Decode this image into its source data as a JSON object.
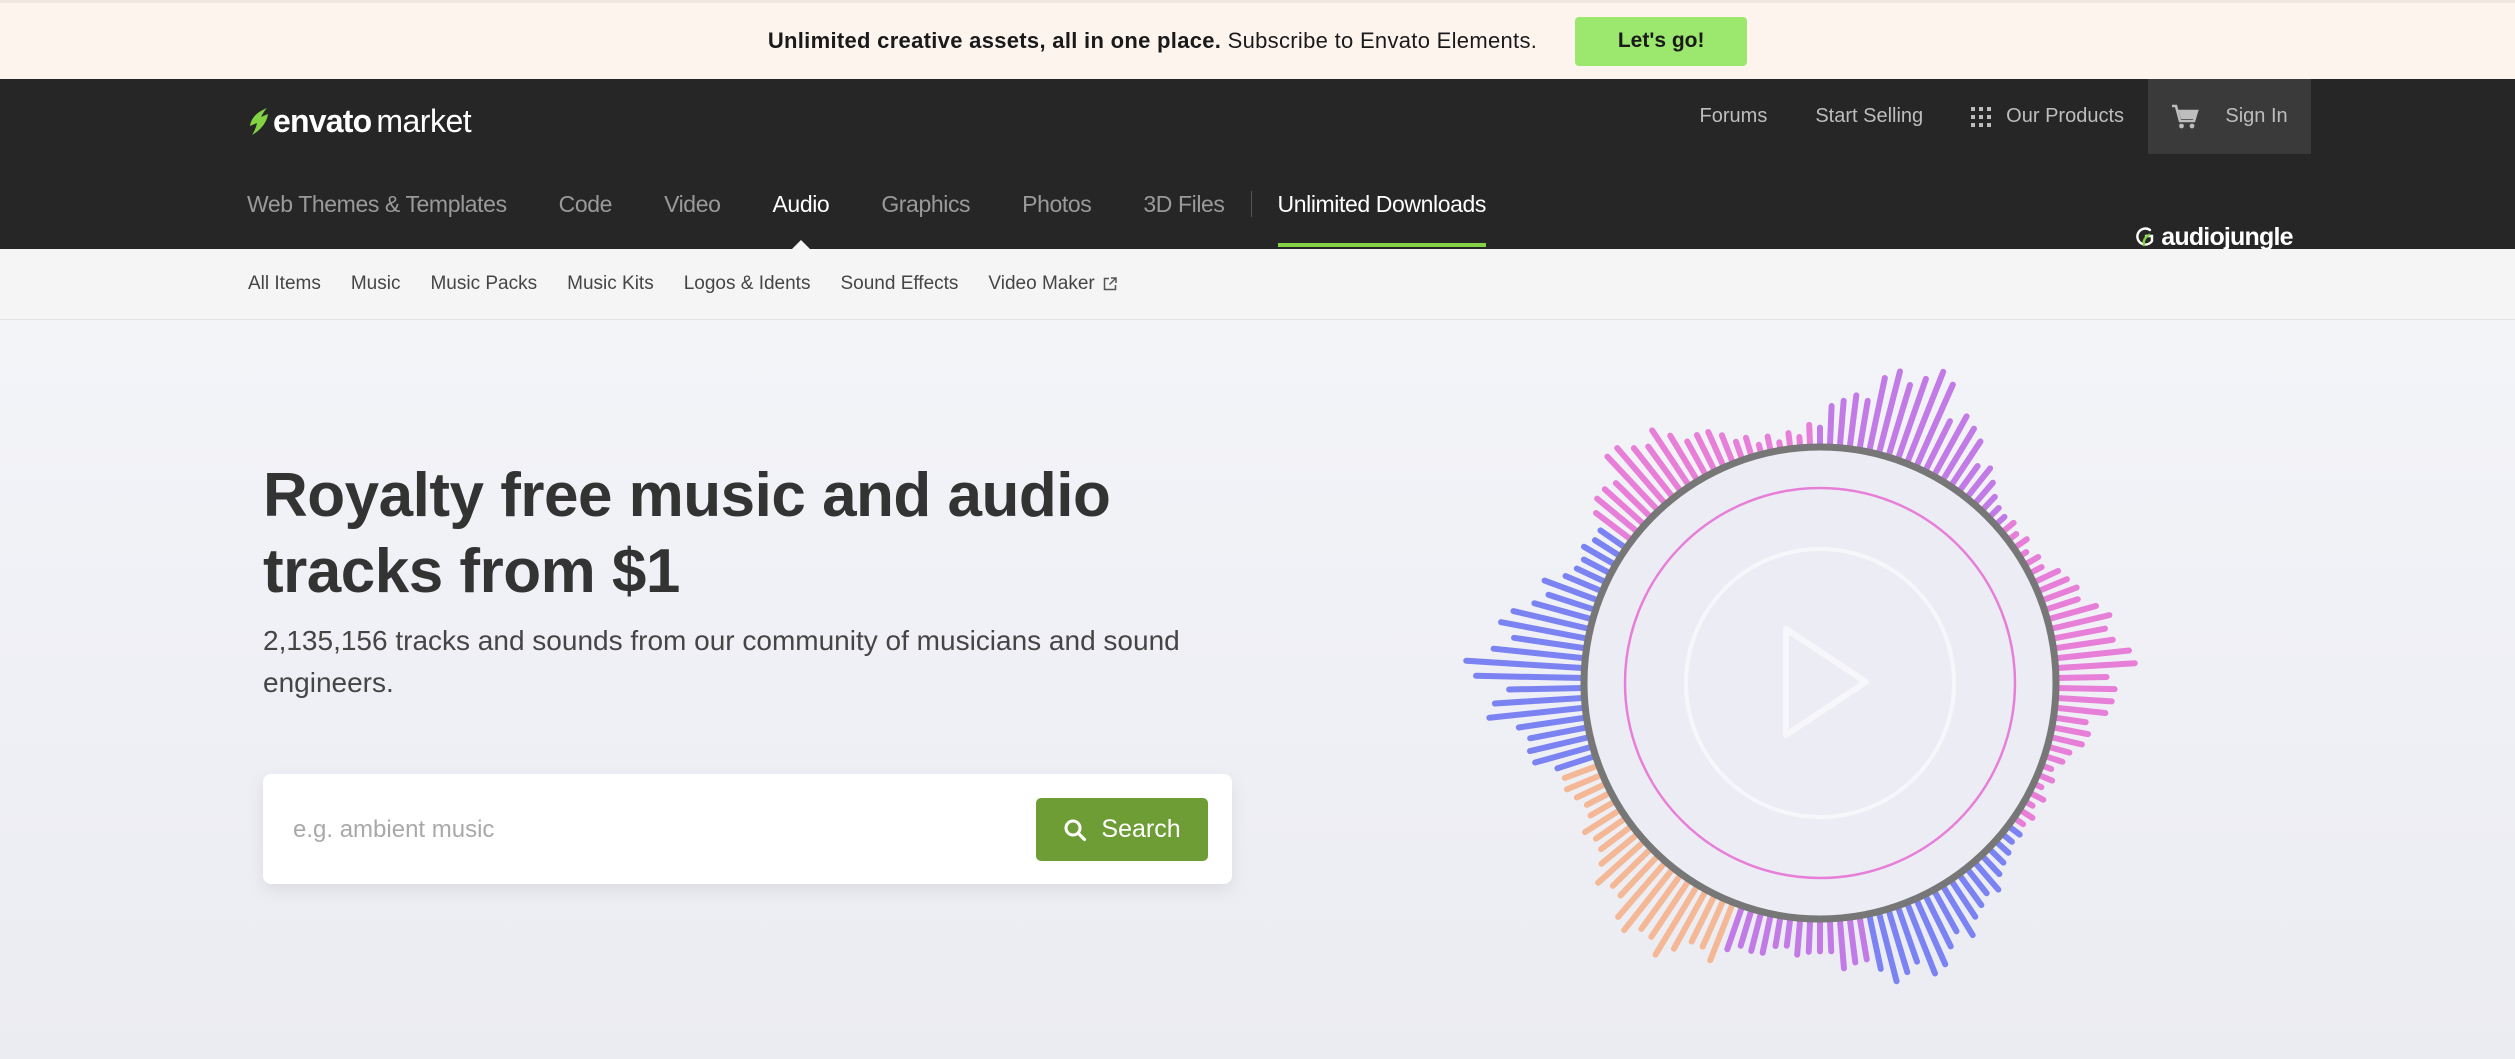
{
  "promo": {
    "bold_text": "Unlimited creative assets, all in one place.",
    "text": "Subscribe to Envato Elements.",
    "button": "Let's go!"
  },
  "logo": {
    "word": "envato",
    "suffix": "market"
  },
  "utility_nav": {
    "forums": "Forums",
    "start_selling": "Start Selling",
    "our_products": "Our Products",
    "sign_in": "Sign In"
  },
  "categories": {
    "items": [
      "Web Themes & Templates",
      "Code",
      "Video",
      "Audio",
      "Graphics",
      "Photos",
      "3D Files"
    ],
    "active": "Audio",
    "unlimited": "Unlimited Downloads"
  },
  "badge": {
    "text": "audiojungle"
  },
  "subnav": {
    "items": [
      "All Items",
      "Music",
      "Music Packs",
      "Music Kits",
      "Logos & Idents",
      "Sound Effects",
      "Video Maker"
    ]
  },
  "hero": {
    "title": "Royalty free music and audio tracks from $1",
    "subtitle": "2,135,156 tracks and sounds from our community of musicians and sound engineers."
  },
  "search": {
    "placeholder": "e.g. ambient music",
    "button": "Search"
  },
  "colors": {
    "accent_green": "#9ce76e",
    "search_green": "#6e9d36",
    "header_dark": "#262626",
    "wave_blue": "#7b83f2",
    "wave_pink": "#e77fd9",
    "wave_purple": "#c27ae6",
    "wave_orange": "#f4b896"
  },
  "icons": {
    "cart": "cart-icon",
    "grid": "grid-icon",
    "search": "search-icon",
    "external": "external-link-icon",
    "play": "play-icon"
  }
}
